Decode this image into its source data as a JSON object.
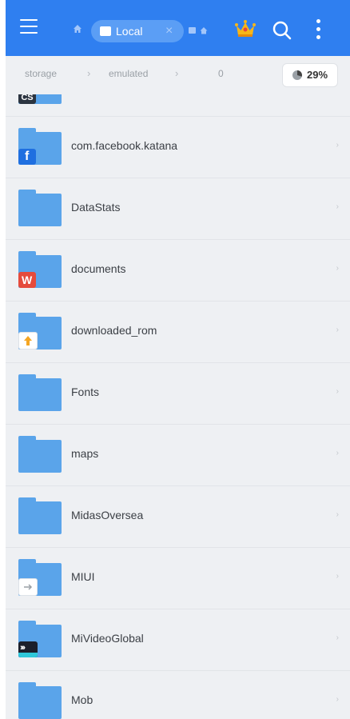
{
  "topbar": {
    "menu_icon": "hamburger-menu-icon",
    "home_icon": "home-icon",
    "tab_label": "Local",
    "tab_close": "×",
    "premium_icon": "crown-icon",
    "search_icon": "search-icon",
    "more_icon": "more-vertical-icon",
    "accent": "#2f7ff0"
  },
  "breadcrumb": {
    "items": [
      "storage",
      "emulated",
      "0"
    ],
    "separator": "›"
  },
  "storage": {
    "percent_label": "29%",
    "percent_value": 29
  },
  "partial_item": {
    "badge_text": "CS"
  },
  "folders": [
    {
      "name": "com.facebook.katana",
      "badge": "facebook-icon"
    },
    {
      "name": "DataStats",
      "badge": ""
    },
    {
      "name": "documents",
      "badge": "wps-icon"
    },
    {
      "name": "downloaded_rom",
      "badge": "upload-arrow-icon"
    },
    {
      "name": "Fonts",
      "badge": ""
    },
    {
      "name": "maps",
      "badge": ""
    },
    {
      "name": "MidasOversea",
      "badge": ""
    },
    {
      "name": "MIUI",
      "badge": "arrow-right-icon"
    },
    {
      "name": "MiVideoGlobal",
      "badge": "video-icon"
    },
    {
      "name": "Mob",
      "badge": ""
    }
  ],
  "chevron": "›"
}
